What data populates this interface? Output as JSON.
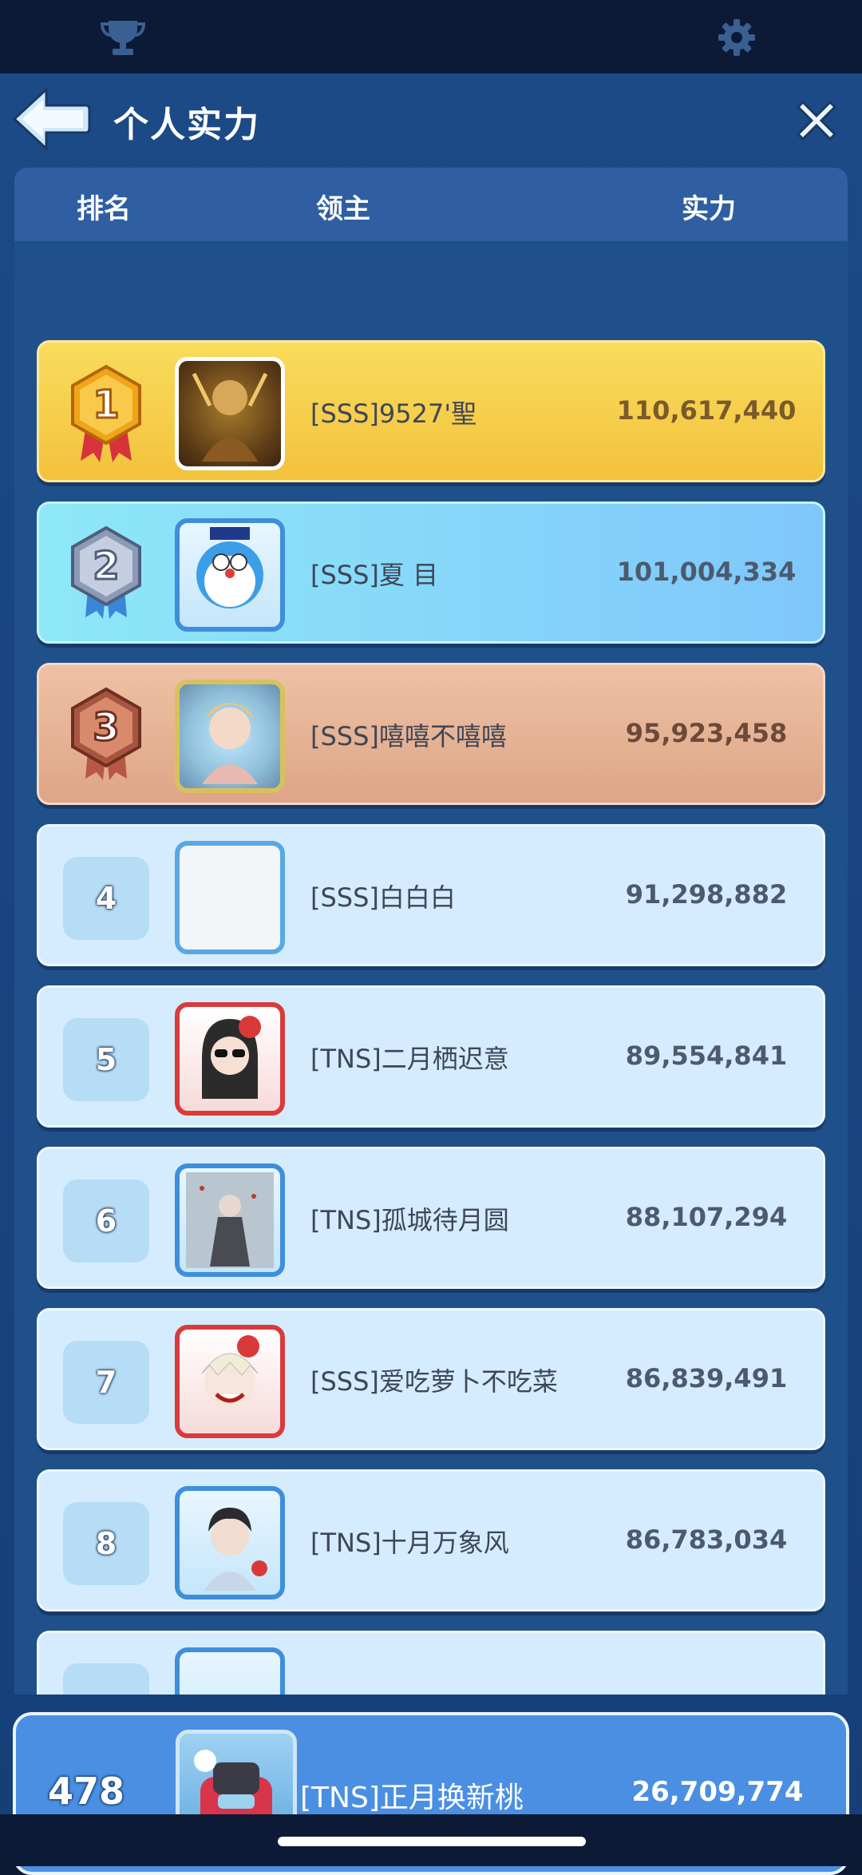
{
  "header": {
    "title": "个人实力",
    "columns": {
      "rank": "排名",
      "lord": "领主",
      "power": "实力"
    }
  },
  "icons": {
    "top_left": "trophy-icon",
    "top_right": "gear-icon",
    "back": "back-arrow-icon",
    "close": "close-icon"
  },
  "colors": {
    "gold": "#f5c842",
    "silver": "#86d3f8",
    "bronze": "#e4b092",
    "plain": "#d4ecfd",
    "self": "#4a8fe2"
  },
  "rankings": [
    {
      "rank": "1",
      "name": "[SSS]9527'聖",
      "power": "110,617,440"
    },
    {
      "rank": "2",
      "name": "[SSS]夏 目",
      "power": "101,004,334"
    },
    {
      "rank": "3",
      "name": "[SSS]嘻嘻不嘻嘻",
      "power": "95,923,458"
    },
    {
      "rank": "4",
      "name": "[SSS]白白白",
      "power": "91,298,882"
    },
    {
      "rank": "5",
      "name": "[TNS]二月栖迟意",
      "power": "89,554,841"
    },
    {
      "rank": "6",
      "name": "[TNS]孤城待月圆",
      "power": "88,107,294"
    },
    {
      "rank": "7",
      "name": "[SSS]爱吃萝卜不吃菜",
      "power": "86,839,491"
    },
    {
      "rank": "8",
      "name": "[TNS]十月万象风",
      "power": "86,783,034"
    }
  ],
  "self": {
    "rank": "478",
    "name": "[TNS]正月换新桃",
    "power": "26,709,774"
  }
}
